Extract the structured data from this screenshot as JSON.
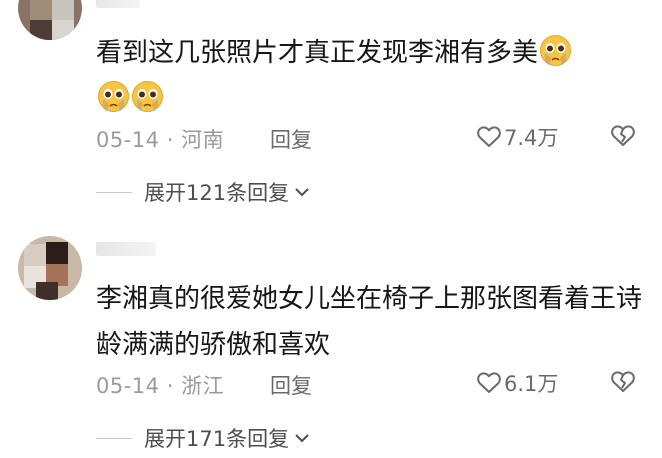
{
  "comments": [
    {
      "text": "看到这几张照片才真正发现李湘有多美",
      "emojis": [
        "crying-face-emoji",
        "crying-face-emoji",
        "crying-face-emoji"
      ],
      "date": "05-14",
      "separator": "·",
      "location": "河南",
      "reply_label": "回复",
      "likes": "7.4万",
      "expand_label": "展开121条回复"
    },
    {
      "text": "李湘真的很爱她女儿坐在椅子上那张图看着王诗龄满满的骄傲和喜欢",
      "emojis": [],
      "date": "05-14",
      "separator": "·",
      "location": "浙江",
      "reply_label": "回复",
      "likes": "6.1万",
      "expand_label": "展开171条回复"
    }
  ],
  "icons": {
    "like": "heart-outline-icon",
    "dislike": "broken-heart-icon",
    "expand": "chevron-down-icon"
  },
  "colors": {
    "text": "#161616",
    "meta": "#9a9a9a",
    "action": "#6a6a6a",
    "emoji": "#f6c544"
  }
}
